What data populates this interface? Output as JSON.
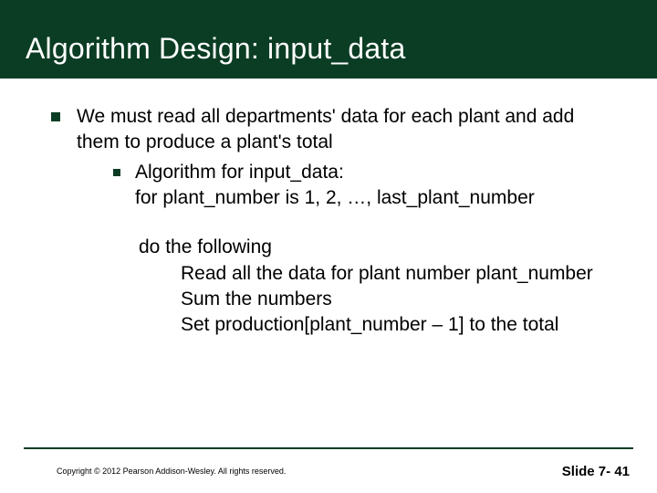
{
  "title": "Algorithm Design: input_data",
  "bullet1": "We must read all departments' data for each plant and add them to produce a plant's total",
  "bullet2_line1": "Algorithm for input_data:",
  "bullet2_line2": "for plant_number is 1, 2, …, last_plant_number",
  "steps_lead": "do the following",
  "step1": "Read all the data for plant number plant_number",
  "step2": "Sum the numbers",
  "step3": "Set production[plant_number – 1] to the total",
  "copyright": "Copyright © 2012 Pearson Addison-Wesley.  All rights reserved.",
  "slide_number": "Slide 7- 41"
}
